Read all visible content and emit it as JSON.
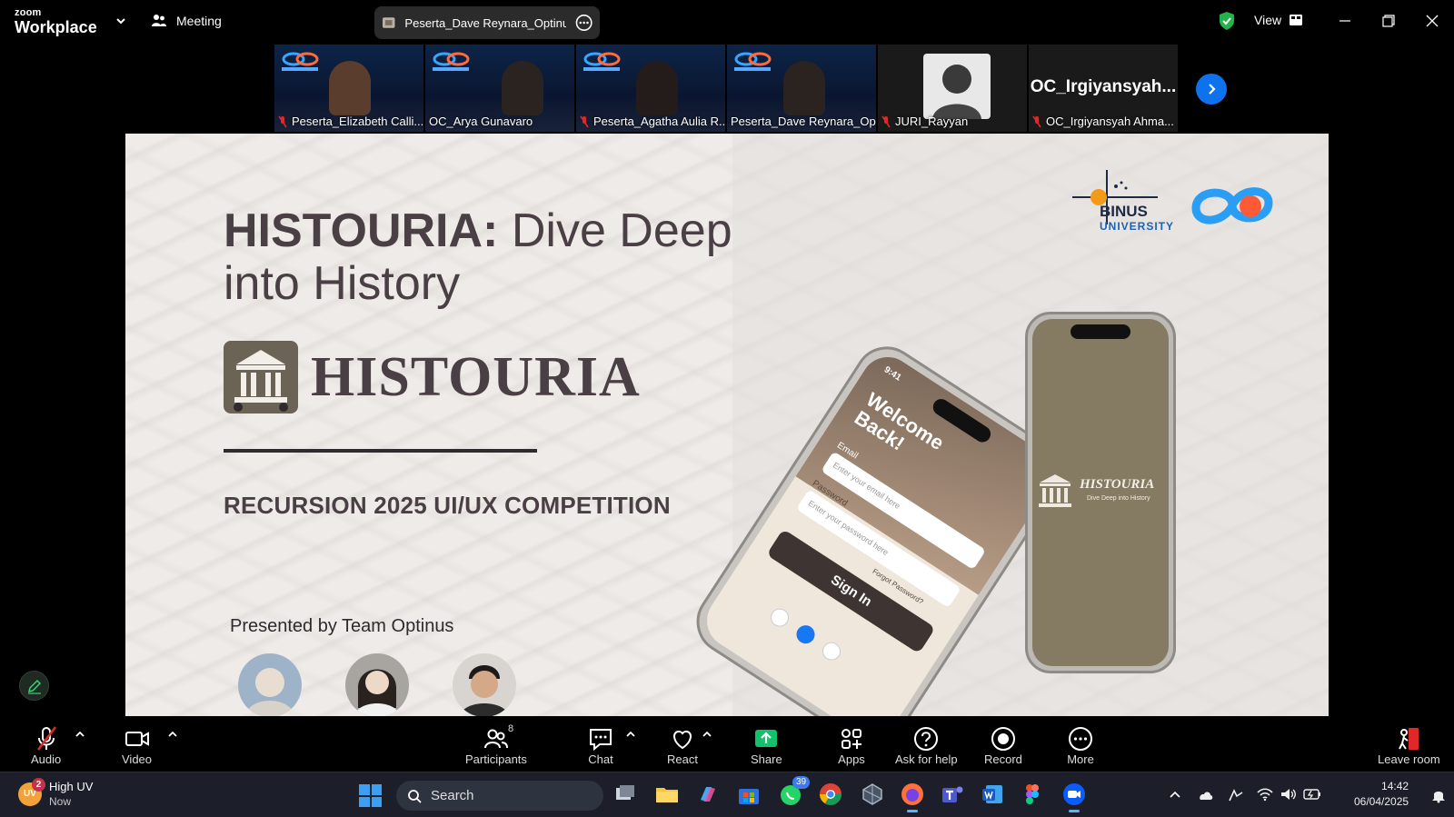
{
  "app": {
    "brand_small": "zoom",
    "brand_big": "Workplace",
    "meeting_label": "Meeting",
    "share_title": "Peserta_Dave Reynara_Optinus's s",
    "view_label": "View"
  },
  "participants_strip": [
    {
      "name": "Peserta_Elizabeth Calli...",
      "muted": true,
      "active": false
    },
    {
      "name": "OC_Arya Gunavaro",
      "muted": false,
      "active": false
    },
    {
      "name": "Peserta_Agatha Aulia R...",
      "muted": true,
      "active": true
    },
    {
      "name": "Peserta_Dave Reynara_Op...",
      "muted": false,
      "active": false
    },
    {
      "name": "JURI_Rayyan",
      "muted": true,
      "active": false
    },
    {
      "name": "OC_Irgiyansyah Ahma...",
      "display_name": "OC_Irgiyansyah...",
      "muted": true,
      "active": false
    }
  ],
  "slide": {
    "title_bold": "HISTOURIA:",
    "title_rest": " Dive Deep into History",
    "brand_word": "HISTOURIA",
    "competition": "RECURSION 2025 UI/UX COMPETITION",
    "presented_by": "Presented by Team Optinus",
    "university_name": "BINUS",
    "university_sub": "UNIVERSITY",
    "phone_welcome": "Welcome Back!",
    "phone_email": "Email",
    "phone_email_ph": "Enter your email here",
    "phone_password": "Password",
    "phone_password_ph": "Enter your password here",
    "phone_forgot": "Forgot Password?",
    "phone_signin": "Sign In",
    "phone_time": "9:41",
    "phone2_brand": "HISTOURIA",
    "phone2_tagline": "Dive Deep into History"
  },
  "toolbar": {
    "audio": "Audio",
    "video": "Video",
    "participants": "Participants",
    "participants_count": "8",
    "chat": "Chat",
    "react": "React",
    "share": "Share",
    "apps": "Apps",
    "help": "Ask for help",
    "record": "Record",
    "more": "More",
    "leave": "Leave room"
  },
  "taskbar": {
    "weather_title": "High UV",
    "weather_sub": "Now",
    "weather_badge": "2",
    "weather_icon_text": "UV",
    "search_label": "Search",
    "whatsapp_badge": "39",
    "time": "14:42",
    "date": "06/04/2025"
  },
  "colors": {
    "accent_green": "#25c16f",
    "zoom_blue": "#0e72ed",
    "share_green": "#13c06b",
    "muted_red": "#e02828",
    "slide_text": "#4a3f45"
  }
}
